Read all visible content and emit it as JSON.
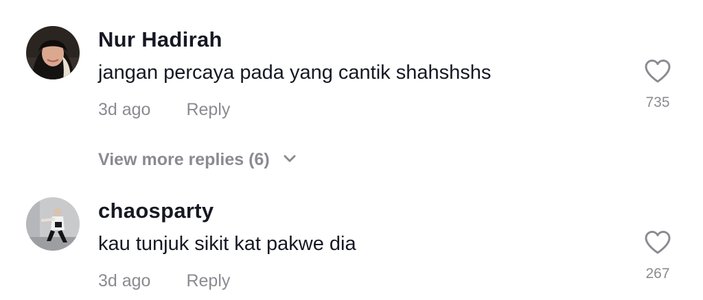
{
  "comments": [
    {
      "username": "Nur Hadirah",
      "text": "jangan percaya pada yang cantik shahshshs",
      "time": "3d ago",
      "reply_label": "Reply",
      "likes": "735",
      "avatar_icon": "user-avatar-photo"
    },
    {
      "username": "chaosparty",
      "text": "kau tunjuk sikit kat pakwe dia",
      "time": "3d ago",
      "reply_label": "Reply",
      "likes": "267",
      "avatar_icon": "user-avatar-photo"
    }
  ],
  "view_more": {
    "label": "View more replies (6)",
    "icon": "chevron-down-icon"
  },
  "colors": {
    "text_primary": "#161823",
    "text_secondary": "#8a8b91"
  }
}
